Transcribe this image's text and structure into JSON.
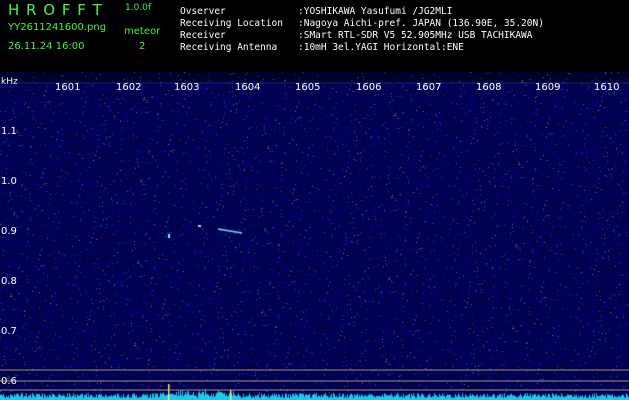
{
  "app": {
    "name": "H R O F F T",
    "version": "1.0.0f"
  },
  "file": {
    "name": "YY2611241600.png",
    "datetime": "26.11.24 16:00"
  },
  "meteor": {
    "label": "meteor",
    "count": "2"
  },
  "info": {
    "labels": [
      "Ovserver",
      "Receiving Location",
      "Receiver",
      "Receiving Antenna"
    ],
    "values": [
      ":YOSHIKAWA Yasufumi /JG2MLI",
      ":Nagoya Aichi-pref. JAPAN (136.90E, 35.20N)",
      ":SMart RTL-SDR V5 52.905MHz USB TACHIKAWA",
      ":10mH 3el.YAGI Horizontal:ENE"
    ]
  },
  "axis": {
    "unit": "kHz",
    "y_ticks": [
      "1.1",
      "1.0",
      "0.9",
      "0.8",
      "0.7",
      "0.6"
    ],
    "x_ticks": [
      "1601",
      "1602",
      "1603",
      "1604",
      "1605",
      "1606",
      "1607",
      "1608",
      "1609",
      "1610"
    ]
  },
  "colors": {
    "header_text": "#4cf04c",
    "background": "#04063a",
    "signal": "#1ec8e6"
  }
}
